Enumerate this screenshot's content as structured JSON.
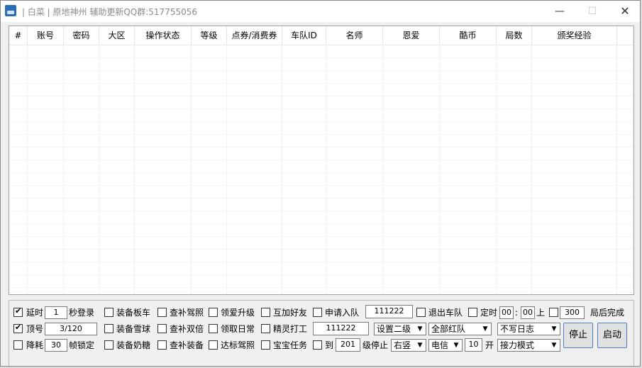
{
  "window": {
    "title": "| 白菜 | 原地神州 辅助更新QQ群:517755056",
    "minimize": "—",
    "maximize": "☐",
    "close": "✕"
  },
  "table": {
    "columns": [
      "#",
      "账号",
      "密码",
      "大区",
      "操作状态",
      "等级",
      "点券/消费券",
      "车队ID",
      "名师",
      "恩爱",
      "酷币",
      "局数",
      "颁奖经验"
    ],
    "rows": []
  },
  "controls": {
    "row1": {
      "delay_label": "延时",
      "delay_value": "1",
      "delay_unit": "秒登录",
      "equip_board": "装备板车",
      "check_license": "查补驾照",
      "love_upgrade": "领爱升级",
      "add_friend": "互加好友",
      "apply_team": "申请入队",
      "team_id": "111222",
      "quit_team": "退出车队",
      "timer_label": "定时",
      "timer_h": "00",
      "timer_sep": ":",
      "timer_m": "00",
      "timer_on": "上",
      "rounds_value": "300",
      "rounds_label": "局后完成"
    },
    "row2": {
      "top_label": "顶号",
      "top_value": "3/120",
      "equip_snowball": "装备雪球",
      "check_double": "查补双倍",
      "daily": "领取日常",
      "sprite_work": "精灵打工",
      "sprite_id": "111222",
      "level_select": "设置二级",
      "team_select": "全部红队",
      "log_select": "不写日志"
    },
    "row3": {
      "reduce_label": "降耗",
      "fps_value": "30",
      "fps_label": "帧锁定",
      "equip_candy": "装备奶糖",
      "check_equip": "查补装备",
      "standard_license": "达标驾照",
      "baby_task": "宝宝任务",
      "to_label": "到",
      "level_value": "201",
      "level_stop": "级停止",
      "dir_select": "右竖",
      "isp_select": "电信",
      "open_value": "10",
      "open_label": "开",
      "mode_select": "接力模式"
    },
    "buttons": {
      "stop": "停止",
      "start": "启动"
    }
  }
}
